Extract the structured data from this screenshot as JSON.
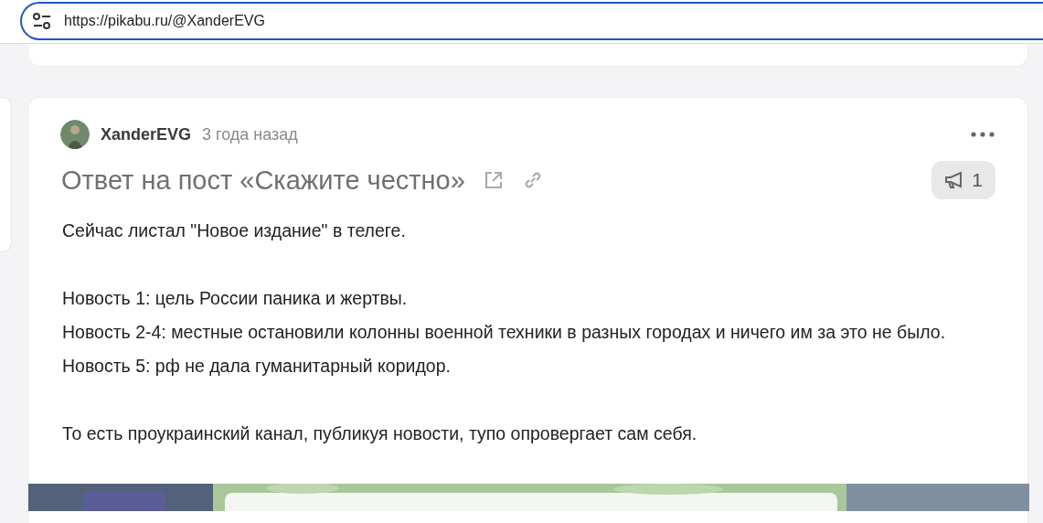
{
  "address_bar": {
    "url": "https://pikabu.ru/@XanderEVG"
  },
  "post": {
    "author": "XanderEVG",
    "time": "3 года назад",
    "title": "Ответ на пост «Скажите честно»",
    "badge_count": "1",
    "paragraphs": [
      [
        "Сейчас листал \"Новое издание\" в телеге."
      ],
      [
        "Новость 1: цель России паника и жертвы.",
        "Новость 2-4: местные остановили колонны военной техники в разных городах и ничего им за это не было.",
        "Новость 5: рф не дала гуманитарный коридор."
      ],
      [
        "То есть проукраинский канал, публикуя новости, тупо опровергает сам себя."
      ]
    ]
  }
}
